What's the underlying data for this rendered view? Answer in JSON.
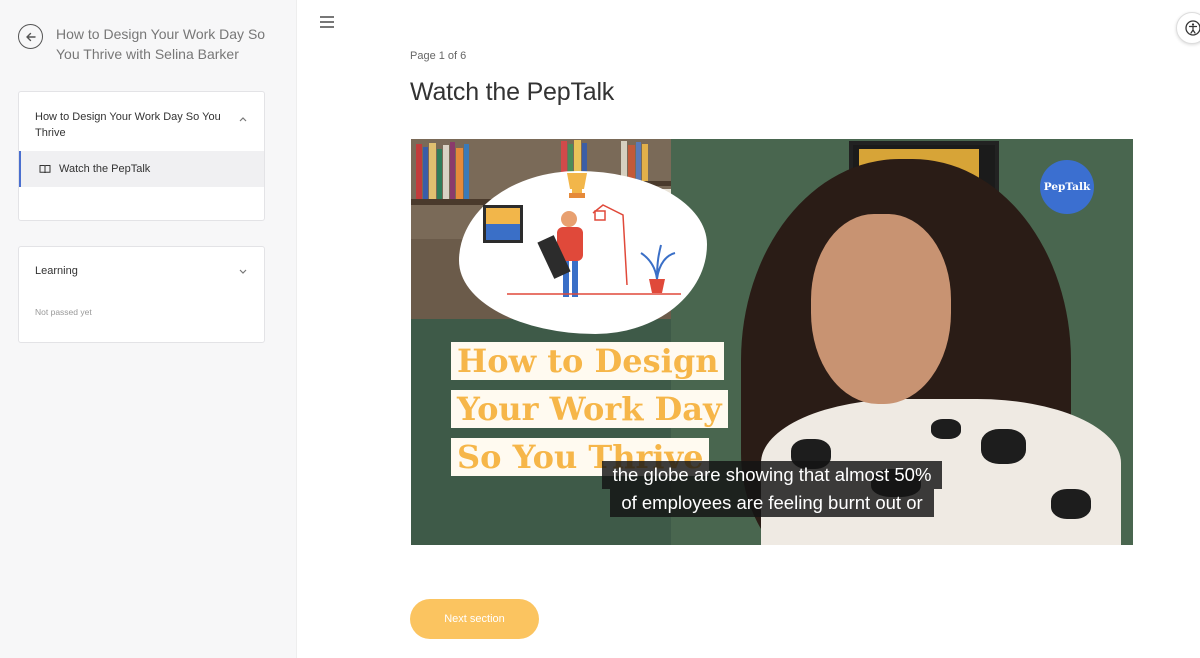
{
  "sidebar": {
    "course_title": "How to Design Your Work Day So You Thrive with Selina Barker",
    "back_icon": "arrow-left-circle-icon",
    "module": {
      "title": "How to Design Your Work Day So You Thrive",
      "items": [
        {
          "label": "Watch the PepTalk",
          "icon": "book-icon"
        }
      ]
    },
    "learning": {
      "title": "Learning",
      "status": "Not passed yet"
    }
  },
  "main": {
    "page_indicator": "Page 1 of 6",
    "title": "Watch the PepTalk",
    "video": {
      "title_lines": [
        "How to Design",
        "Your Work Day",
        "So You Thrive"
      ],
      "badge": "PepTalk",
      "caption_lines": [
        "the globe are showing that almost 50%",
        "of employees are feeling burnt out or"
      ]
    },
    "next_button": "Next section"
  },
  "colors": {
    "accent_blue": "#4a6fcf",
    "next_button": "#fbc460",
    "title_text_orange": "#f6b649",
    "badge_blue": "#3b6fd0"
  }
}
